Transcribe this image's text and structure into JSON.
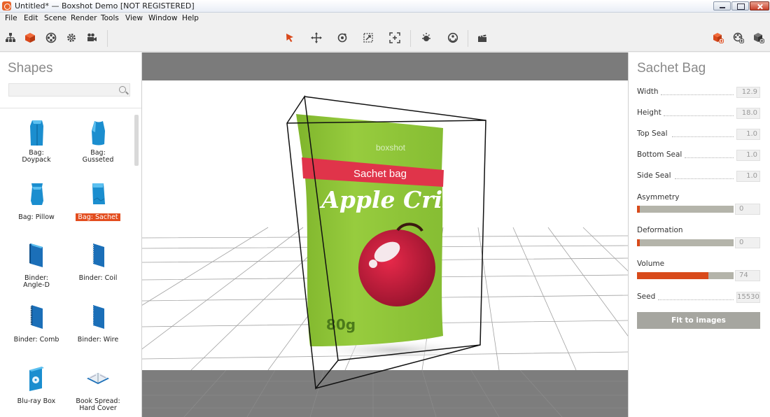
{
  "window": {
    "title": "Untitled* — Boxshot Demo [NOT REGISTERED]"
  },
  "menu": {
    "items": [
      "File",
      "Edit",
      "Scene",
      "Render",
      "Tools",
      "View",
      "Window",
      "Help"
    ]
  },
  "toolbar": {
    "left_icons": [
      "hierarchy-icon",
      "shape-cube-icon",
      "materials-icon",
      "settings-gear-icon",
      "camera-icon"
    ],
    "center_icons": [
      "select-arrow-icon",
      "move-icon",
      "rotate-icon",
      "scale-icon",
      "fit-icon",
      "light-icon",
      "environment-icon",
      "render-clapper-icon"
    ],
    "right_icons": [
      "add-shape-icon",
      "add-material-icon",
      "add-object-icon"
    ],
    "accent_color": "#e34d1e"
  },
  "shapes_panel": {
    "title": "Shapes",
    "search_placeholder": "",
    "items": [
      {
        "label_line1": "Bag:",
        "label_line2": "Doypack",
        "icon": "bag-doypack-icon",
        "selected": false
      },
      {
        "label_line1": "Bag:",
        "label_line2": "Gusseted",
        "icon": "bag-gusseted-icon",
        "selected": false
      },
      {
        "label_line1": "Bag: Pillow",
        "label_line2": "",
        "icon": "bag-pillow-icon",
        "selected": false
      },
      {
        "label_line1": "Bag: Sachet",
        "label_line2": "",
        "icon": "bag-sachet-icon",
        "selected": true
      },
      {
        "label_line1": "Binder:",
        "label_line2": "Angle-D",
        "icon": "binder-angle-d-icon",
        "selected": false
      },
      {
        "label_line1": "Binder: Coil",
        "label_line2": "",
        "icon": "binder-coil-icon",
        "selected": false
      },
      {
        "label_line1": "Binder: Comb",
        "label_line2": "",
        "icon": "binder-comb-icon",
        "selected": false
      },
      {
        "label_line1": "Binder: Wire",
        "label_line2": "",
        "icon": "binder-wire-icon",
        "selected": false
      },
      {
        "label_line1": "Blu-ray Box",
        "label_line2": "",
        "icon": "bluray-box-icon",
        "selected": false
      },
      {
        "label_line1": "Book Spread:",
        "label_line2": "Hard Cover",
        "icon": "book-spread-icon",
        "selected": false
      }
    ]
  },
  "viewport": {
    "product": {
      "brand": "boxshot",
      "banner": "Sachet bag",
      "name": "Apple Cris",
      "weight": "80g"
    },
    "colors": {
      "bag_green": "#8fc43a",
      "banner_red": "#e0344a",
      "apple_red": "#c91c3a",
      "background": "#7b7b7b",
      "floor": "#ffffff"
    }
  },
  "properties_panel": {
    "title": "Sachet Bag",
    "fields": [
      {
        "label": "Width",
        "value": "12.9"
      },
      {
        "label": "Height",
        "value": "18.0"
      },
      {
        "label": "Top Seal",
        "value": "1.0"
      },
      {
        "label": "Bottom Seal",
        "value": "1.0"
      },
      {
        "label": "Side Seal",
        "value": "1.0"
      }
    ],
    "sliders": [
      {
        "label": "Asymmetry",
        "value": "0",
        "fraction": 0.0
      },
      {
        "label": "Deformation",
        "value": "0",
        "fraction": 0.0
      },
      {
        "label": "Volume",
        "value": "74",
        "fraction": 0.74
      }
    ],
    "seed": {
      "label": "Seed",
      "value": "15530"
    },
    "fit_button_label": "Fit to images"
  }
}
